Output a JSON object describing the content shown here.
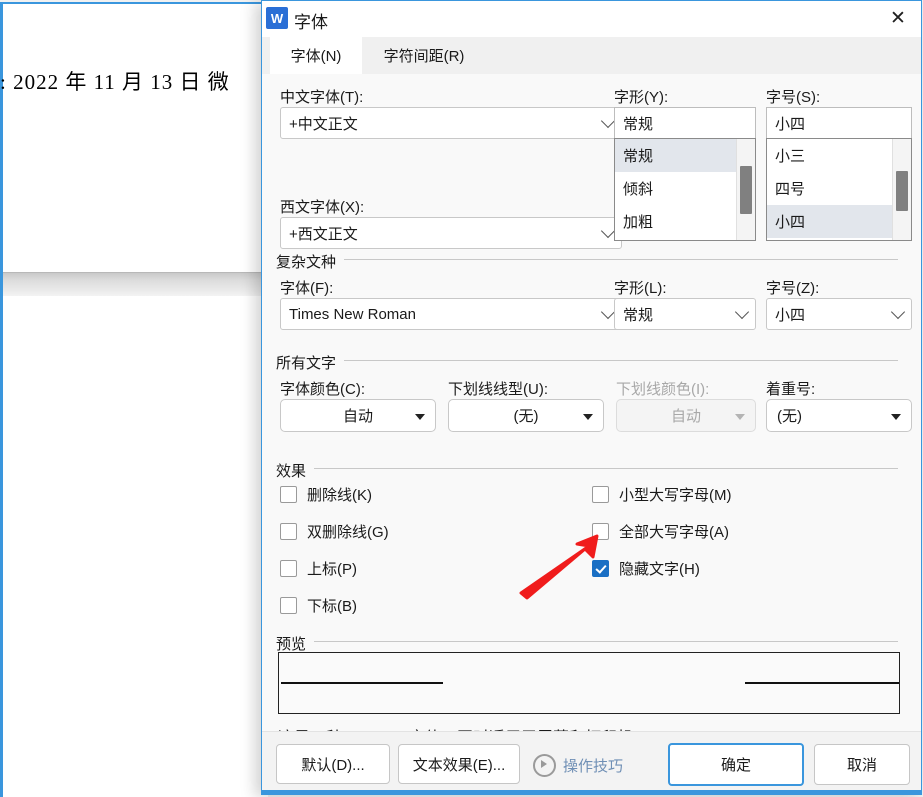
{
  "background": {
    "document_text": ": 2022 年 11 月 13 日  微"
  },
  "dialog": {
    "app_icon_letter": "W",
    "title": "字体",
    "close_glyph": "✕",
    "tabs": [
      {
        "label": "字体(N)",
        "active": true
      },
      {
        "label": "字符间距(R)",
        "active": false
      }
    ],
    "chinese_font": {
      "label": "中文字体(T):",
      "value": "+中文正文"
    },
    "western_font": {
      "label": "西文字体(X):",
      "value": "+西文正文"
    },
    "font_style": {
      "label": "字形(Y):",
      "value": "常规",
      "options": [
        "常规",
        "倾斜",
        "加粗"
      ],
      "selected": "常规"
    },
    "font_size": {
      "label": "字号(S):",
      "value": "小四",
      "options": [
        "小三",
        "四号",
        "小四"
      ],
      "selected": "小四"
    },
    "complex_script": {
      "group_label": "复杂文种",
      "font": {
        "label": "字体(F):",
        "value": "Times New Roman"
      },
      "style": {
        "label": "字形(L):",
        "value": "常规"
      },
      "size": {
        "label": "字号(Z):",
        "value": "小四"
      }
    },
    "all_text": {
      "group_label": "所有文字",
      "font_color": {
        "label": "字体颜色(C):",
        "value": "自动",
        "disabled": false
      },
      "underline_style": {
        "label": "下划线线型(U):",
        "value": "(无)",
        "disabled": false
      },
      "underline_color": {
        "label": "下划线颜色(I):",
        "value": "自动",
        "disabled": true
      },
      "emphasis_mark": {
        "label": "着重号:",
        "value": "(无)",
        "disabled": false
      }
    },
    "effects": {
      "group_label": "效果",
      "left_column": [
        {
          "label": "删除线(K)",
          "checked": false
        },
        {
          "label": "双删除线(G)",
          "checked": false
        },
        {
          "label": "上标(P)",
          "checked": false
        },
        {
          "label": "下标(B)",
          "checked": false
        }
      ],
      "right_column": [
        {
          "label": "小型大写字母(M)",
          "checked": false
        },
        {
          "label": "全部大写字母(A)",
          "checked": false
        },
        {
          "label": "隐藏文字(H)",
          "checked": true
        }
      ]
    },
    "preview": {
      "group_label": "预览",
      "note": "这是一种TrueType字体，同时适用于屏幕和打印机。"
    },
    "footer": {
      "default_button": "默认(D)...",
      "text_effects_button": "文本效果(E)...",
      "tips_link": "操作技巧",
      "ok_button": "确定",
      "cancel_button": "取消"
    }
  },
  "colors": {
    "accent": "#3a96dd",
    "checkbox_checked": "#1a6fc4",
    "annotation_arrow": "#f01c1c",
    "link": "#6f8fb5"
  }
}
